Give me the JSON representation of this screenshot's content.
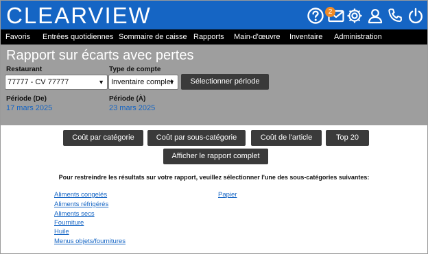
{
  "header": {
    "logo": "CLEARVIEW",
    "badge_count": "2",
    "icons": [
      "help-icon",
      "mail-icon",
      "gear-icon",
      "user-icon",
      "phone-icon",
      "power-icon"
    ]
  },
  "nav": {
    "items": [
      "Favoris",
      "Entrées quotidiennes",
      "Sommaire de caisse",
      "Rapports",
      "Main-d'œuvre",
      "Inventaire",
      "Administration"
    ]
  },
  "report": {
    "title": "Rapport sur écarts avec pertes",
    "restaurant_label": "Restaurant",
    "restaurant_value": "77777 - CV 77777",
    "account_type_label": "Type de compte",
    "account_type_value": "Inventaire complet",
    "select_period_label": "Sélectionner période",
    "period_from_label": "Période (De)",
    "period_from_value": "17 mars 2025",
    "period_to_label": "Période (À)",
    "period_to_value": "23 mars 2025"
  },
  "actions": {
    "cost_by_category": "Coût par catégorie",
    "cost_by_subcategory": "Coût par sous-catégorie",
    "cost_by_item": "Coût de l'article",
    "top20": "Top 20",
    "show_full_report": "Afficher le rapport complet"
  },
  "subcategories": {
    "instruction": "Pour restreindre les résultats sur votre rapport, veuillez sélectionner l'une des sous-catégories suivantes:",
    "left": [
      "Aliments congelés",
      "Aliments réfrigérés",
      "Aliments secs",
      "Fourniture",
      "Huile",
      "Menus objets/fournitures"
    ],
    "right": [
      "Papier"
    ]
  },
  "colors": {
    "header_blue": "#1565c4",
    "nav_black": "#000000",
    "panel_grey": "#9e9e9e",
    "button_dark": "#3a3a3a",
    "badge_orange": "#f08a24",
    "link_blue": "#1565c4"
  }
}
